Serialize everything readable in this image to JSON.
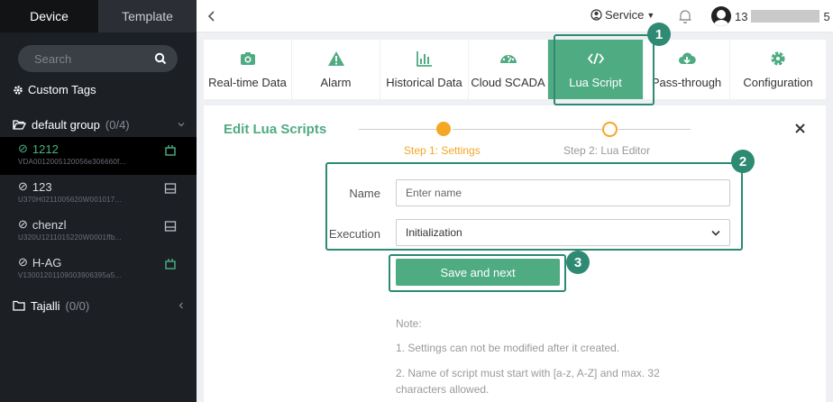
{
  "sidebar": {
    "tabs": [
      {
        "label": "Device",
        "active": true
      },
      {
        "label": "Template",
        "active": false
      }
    ],
    "search_placeholder": "Search",
    "custom_tags": "Custom Tags",
    "groups": [
      {
        "name": "default group",
        "count": "(0/4)"
      },
      {
        "name": "Tajalli",
        "count": "(0/0)"
      }
    ],
    "devices": [
      {
        "name": "1212",
        "serial": "VDA0012005120056e306660f...",
        "selected": true,
        "icon": "tool-icon"
      },
      {
        "name": "123",
        "serial": "U370H0211005620W001017...",
        "selected": false,
        "icon": "window-icon"
      },
      {
        "name": "chenzl",
        "serial": "U320U1211015220W0001ffb...",
        "selected": false,
        "icon": "window-icon"
      },
      {
        "name": "H-AG",
        "serial": "V13001201109003906395a5...",
        "selected": false,
        "icon": "tool-icon"
      }
    ]
  },
  "header": {
    "service": "Service",
    "user": "13"
  },
  "menu": [
    {
      "label": "Real-time Data",
      "icon": "camera-icon",
      "active": false
    },
    {
      "label": "Alarm",
      "icon": "warning-icon",
      "active": false
    },
    {
      "label": "Historical Data",
      "icon": "bar-chart-icon",
      "active": false
    },
    {
      "label": "Cloud SCADA",
      "icon": "dashboard-icon",
      "active": false
    },
    {
      "label": "Lua Script",
      "icon": "code-icon",
      "active": true
    },
    {
      "label": "Pass-through",
      "icon": "cloud-download-icon",
      "active": false
    },
    {
      "label": "Configuration",
      "icon": "gear-icon",
      "active": false
    }
  ],
  "content": {
    "title": "Edit Lua Scripts",
    "steps": [
      "Step 1: Settings",
      "Step 2: Lua Editor"
    ],
    "name_label": "Name",
    "name_placeholder": "Enter name",
    "execution_label": "Execution",
    "execution_value": "Initialization",
    "save_label": "Save and next",
    "note_title": "Note:",
    "notes": [
      "1. Settings can not be modified after it created.",
      "2. Name of script must start with [a-z, A-Z] and max. 32",
      "characters allowed."
    ]
  },
  "callouts": [
    "1",
    "2",
    "3"
  ],
  "colors": {
    "accent": "#4fab82",
    "step": "#f5a623",
    "callout": "#2e8a73",
    "sidebar": "#1c1f24"
  }
}
